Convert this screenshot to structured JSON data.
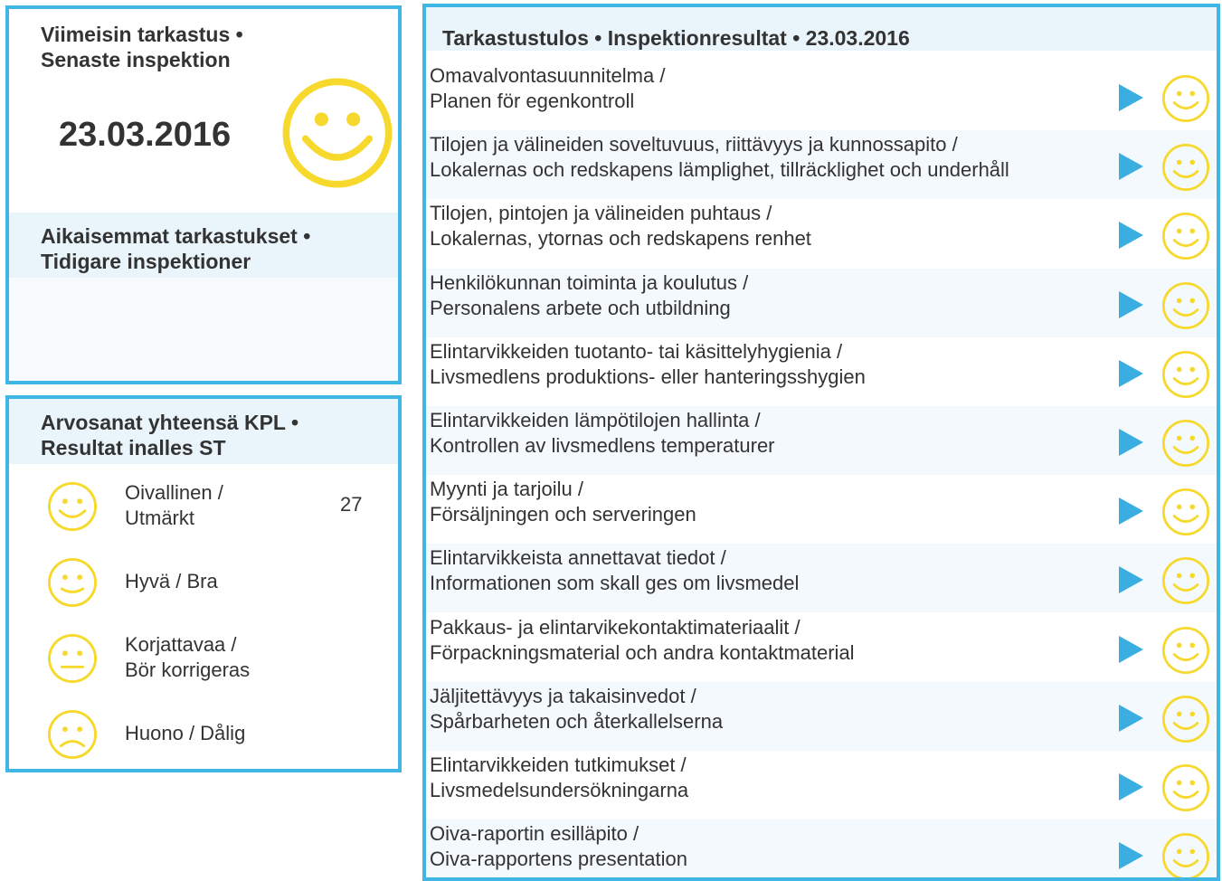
{
  "latest": {
    "title_line1": "Viimeisin tarkastus •",
    "title_line2": "Senaste inspektion",
    "date": "23.03.2016",
    "smiley": "happy-smiley-icon"
  },
  "previous": {
    "title_line1": "Aikaisemmat tarkastukset •",
    "title_line2": "Tidigare inspektioner"
  },
  "totals": {
    "title_line1": "Arvosanat yhteensä KPL •",
    "title_line2": "Resultat inalles ST",
    "rows": [
      {
        "line1": "Oivallinen /",
        "line2": "Utmärkt",
        "count": "27",
        "icon": "excellent-smiley-icon"
      },
      {
        "line1": "Hyvä / Bra",
        "line2": "",
        "count": "",
        "icon": "good-smiley-icon"
      },
      {
        "line1": "Korjattavaa /",
        "line2": "Bör korrigeras",
        "count": "",
        "icon": "neutral-smiley-icon"
      },
      {
        "line1": "Huono / Dålig",
        "line2": "",
        "count": "",
        "icon": "sad-smiley-icon"
      }
    ]
  },
  "results": {
    "title": "Tarkastustulos • Inspektionresultat • 23.03.2016",
    "items": [
      {
        "line1": "Omavalvontasuunnitelma /",
        "line2": "Planen för egenkontroll"
      },
      {
        "line1": "Tilojen ja välineiden soveltuvuus, riittävyys ja kunnossapito /",
        "line2": "Lokalernas och redskapens lämplighet, tillräcklighet och underhåll"
      },
      {
        "line1": "Tilojen, pintojen ja välineiden puhtaus /",
        "line2": "Lokalernas, ytornas och redskapens renhet"
      },
      {
        "line1": "Henkilökunnan toiminta ja koulutus /",
        "line2": "Personalens arbete och utbildning"
      },
      {
        "line1": "Elintarvikkeiden tuotanto- tai käsittelyhygienia /",
        "line2": "Livsmedlens produktions- eller hanteringsshygien"
      },
      {
        "line1": "Elintarvikkeiden lämpötilojen hallinta /",
        "line2": "Kontrollen av livsmedlens temperaturer"
      },
      {
        "line1": "Myynti ja tarjoilu /",
        "line2": "Försäljningen och serveringen"
      },
      {
        "line1": "Elintarvikkeista annettavat tiedot /",
        "line2": "Informationen som skall ges om livsmedel"
      },
      {
        "line1": "Pakkaus- ja elintarvikekontaktimateriaalit /",
        "line2": "Förpackningsmaterial och andra kontaktmaterial"
      },
      {
        "line1": "Jäljitettävyys ja takaisinvedot /",
        "line2": "Spårbarheten och återkallelserna"
      },
      {
        "line1": "Elintarvikkeiden tutkimukset /",
        "line2": "Livsmedelsundersökningarna"
      },
      {
        "line1": "Oiva-raportin esilläpito /",
        "line2": "Oiva-rapportens presentation"
      }
    ]
  },
  "colors": {
    "border": "#3fb6e3",
    "arrow": "#3aaee0",
    "smiley": "#f6d92c",
    "header_bg": "#e9f4fb"
  }
}
